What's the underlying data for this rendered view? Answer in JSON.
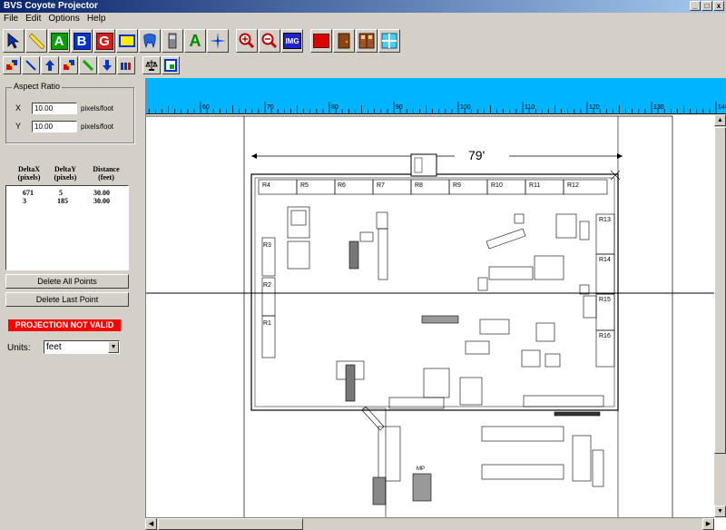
{
  "window": {
    "title": "BVS Coyote Projector",
    "minimize": "_",
    "maximize": "□",
    "close": "x"
  },
  "menu": [
    "File",
    "Edit",
    "Options",
    "Help"
  ],
  "toolbar": {
    "letters": {
      "a": "A",
      "b": "B",
      "g": "G",
      "a2": "A",
      "img": "IMG"
    },
    "colors": {
      "a": "#00a000",
      "b": "#0033cc",
      "g": "#cc2222",
      "a2": "#008800",
      "img": "#2222cc",
      "red_box": "#dd0000"
    }
  },
  "aspect": {
    "label": "Aspect Ratio",
    "x_label": "X",
    "x_value": "10.00",
    "y_label": "Y",
    "y_value": "10.00",
    "unit": "pixels/foot"
  },
  "table": {
    "headers": [
      {
        "line1": "DeltaX",
        "line2": "(pixels)"
      },
      {
        "line1": "DeltaY",
        "line2": "(pixels)"
      },
      {
        "line1": "Distance",
        "line2": "(feet)"
      }
    ],
    "rows": [
      {
        "dx": "671",
        "dy": "5",
        "dist": "30.00"
      },
      {
        "dx": "3",
        "dy": "185",
        "dist": "30.00"
      }
    ]
  },
  "buttons": {
    "delete_all": "Delete All Points",
    "delete_last": "Delete Last Point"
  },
  "status": {
    "projection": "PROJECTION NOT VALID"
  },
  "units": {
    "label": "Units:",
    "value": "feet"
  },
  "ruler": {
    "labels": [
      "60",
      "70",
      "80",
      "90",
      "100",
      "110",
      "120",
      "130",
      "140"
    ]
  },
  "drawing": {
    "dimension": "79'",
    "rooms_top": [
      "R4",
      "R5",
      "R6",
      "R7",
      "R8",
      "R9",
      "R10",
      "R11",
      "R12"
    ],
    "rooms_left": [
      "R3",
      "R2",
      "R1"
    ],
    "rooms_right": [
      "R13",
      "R14",
      "R15",
      "R16"
    ],
    "mp_label": "MP"
  }
}
